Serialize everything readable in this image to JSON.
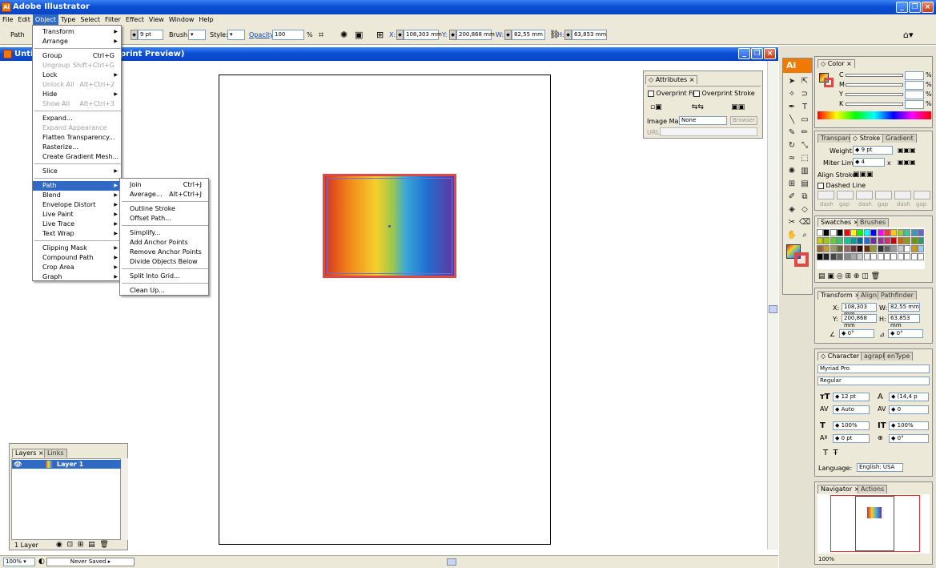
{
  "app": {
    "title": "Adobe Illustrator",
    "icon": "Ai"
  },
  "menubar": [
    "File",
    "Edit",
    "Object",
    "Type",
    "Select",
    "Filter",
    "Effect",
    "View",
    "Window",
    "Help"
  ],
  "control": {
    "selection": "Path",
    "stroke_weight": "9 pt",
    "brush_label": "Brush:",
    "style_label": "Style:",
    "opacity_label": "Opacity:",
    "opacity": "100",
    "pct": "%",
    "x_label": "X:",
    "x": "108,303 mm",
    "y_label": "Y:",
    "y": "200,868 mm",
    "w_label": "W:",
    "w": "82,55 mm",
    "h_label": "H:",
    "h": "63,853 mm"
  },
  "document": {
    "title_left": "Untit",
    "title_right": "print Preview)"
  },
  "object_menu": [
    {
      "label": "Transform",
      "arrow": true
    },
    {
      "label": "Arrange",
      "arrow": true
    },
    {
      "sep": true
    },
    {
      "label": "Group",
      "shortcut": "Ctrl+G"
    },
    {
      "label": "Ungroup",
      "shortcut": "Shift+Ctrl+G",
      "disabled": true
    },
    {
      "label": "Lock",
      "arrow": true
    },
    {
      "label": "Unlock All",
      "shortcut": "Alt+Ctrl+2",
      "disabled": true
    },
    {
      "label": "Hide",
      "arrow": true
    },
    {
      "label": "Show All",
      "shortcut": "Alt+Ctrl+3",
      "disabled": true
    },
    {
      "sep": true
    },
    {
      "label": "Expand..."
    },
    {
      "label": "Expand Appearance",
      "disabled": true
    },
    {
      "label": "Flatten Transparency..."
    },
    {
      "label": "Rasterize..."
    },
    {
      "label": "Create Gradient Mesh..."
    },
    {
      "sep": true
    },
    {
      "label": "Slice",
      "arrow": true
    },
    {
      "sep": true
    },
    {
      "label": "Path",
      "arrow": true,
      "selected": true
    },
    {
      "label": "Blend",
      "arrow": true
    },
    {
      "label": "Envelope Distort",
      "arrow": true
    },
    {
      "label": "Live Paint",
      "arrow": true
    },
    {
      "label": "Live Trace",
      "arrow": true
    },
    {
      "label": "Text Wrap",
      "arrow": true
    },
    {
      "sep": true
    },
    {
      "label": "Clipping Mask",
      "arrow": true
    },
    {
      "label": "Compound Path",
      "arrow": true
    },
    {
      "label": "Crop Area",
      "arrow": true
    },
    {
      "label": "Graph",
      "arrow": true
    }
  ],
  "path_menu": [
    {
      "label": "Join",
      "shortcut": "Ctrl+J"
    },
    {
      "label": "Average...",
      "shortcut": "Alt+Ctrl+J"
    },
    {
      "sep": true
    },
    {
      "label": "Outline Stroke"
    },
    {
      "label": "Offset Path..."
    },
    {
      "sep": true
    },
    {
      "label": "Simplify..."
    },
    {
      "label": "Add Anchor Points"
    },
    {
      "label": "Remove Anchor Points"
    },
    {
      "label": "Divide Objects Below"
    },
    {
      "sep": true
    },
    {
      "label": "Split Into Grid..."
    },
    {
      "sep": true
    },
    {
      "label": "Clean Up..."
    }
  ],
  "attributes": {
    "tab": "Attributes",
    "overprint_fill": "Overprint Fill",
    "overprint_stroke": "Overprint Stroke",
    "image_map_label": "Image Map:",
    "image_map": "None",
    "browser": "Browser",
    "url_label": "URL:"
  },
  "layers": {
    "tabs": [
      "Layers",
      "Links"
    ],
    "layer_name": "Layer 1",
    "count": "1 Layer"
  },
  "status": {
    "zoom": "100%",
    "state": "Never Saved"
  },
  "color_panel": {
    "tab": "Color",
    "channels": [
      "C",
      "M",
      "Y",
      "K"
    ],
    "pct": "%"
  },
  "stroke_panel": {
    "tabs": [
      "Transpare",
      "Stroke",
      "Gradient"
    ],
    "weight_label": "Weight:",
    "weight": "9 pt",
    "miter_label": "Miter Limit:",
    "miter": "4",
    "x": "x",
    "align_label": "Align Stroke:",
    "dashed": "Dashed Line",
    "dash_labels": [
      "dash",
      "gap",
      "dash",
      "gap",
      "dash",
      "gap"
    ]
  },
  "swatches": {
    "tabs": [
      "Swatches",
      "Brushes"
    ]
  },
  "transform_panel": {
    "tabs": [
      "Transform",
      "Align",
      "Pathfinder"
    ],
    "x_label": "X:",
    "x": "108,303 mm",
    "w_label": "W:",
    "w": "82,55 mm",
    "y_label": "Y:",
    "y": "200,868 mm",
    "h_label": "H:",
    "h": "63,853 mm",
    "angle": "0°",
    "shear": "0°"
  },
  "character_panel": {
    "tabs": [
      "Character",
      "agraph",
      "enType"
    ],
    "font": "Myriad Pro",
    "style": "Regular",
    "size": "12 pt",
    "leading": "(14,4 p",
    "kerning": "Auto",
    "tracking": "0",
    "vscale": "100%",
    "hscale": "100%",
    "baseline": "0 pt",
    "rotation": "0°",
    "language_label": "Language:",
    "language": "English: USA"
  },
  "navigator": {
    "tabs": [
      "Navigator",
      "Actions"
    ],
    "zoom": "100%"
  },
  "colors": {
    "accent": "#316ac5",
    "titlebar": "#0a4fd6",
    "panel": "#ece9d8"
  }
}
